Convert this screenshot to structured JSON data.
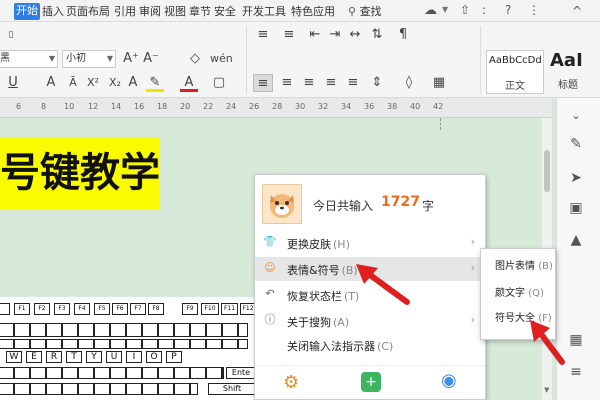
{
  "menubar": {
    "tabs": [
      {
        "label": "开始"
      },
      {
        "label": "插入"
      },
      {
        "label": "页面布局"
      },
      {
        "label": "引用"
      },
      {
        "label": "审阅"
      },
      {
        "label": "视图"
      },
      {
        "label": "章节"
      },
      {
        "label": "安全"
      },
      {
        "label": "开发工具"
      },
      {
        "label": "特色应用"
      }
    ],
    "search_label": "查找",
    "help_symbol": "?",
    "more_symbol": ":",
    "collapse_symbol": "^"
  },
  "ribbon": {
    "font_name": "黑",
    "font_size": "小初",
    "styles": [
      {
        "sample": "AaBbCcDd",
        "label": "正文"
      },
      {
        "sample": "AaI",
        "label": "标题"
      }
    ],
    "accent_color": "#2f7ee8"
  },
  "ruler": {
    "ticks": [
      "6",
      "8",
      "10",
      "12",
      "14",
      "16",
      "18",
      "20",
      "22",
      "24",
      "26",
      "28",
      "30",
      "32",
      "34",
      "36",
      "38",
      "40",
      "42"
    ]
  },
  "document": {
    "heading": "号键教学"
  },
  "keyboard": {
    "f_row": [
      "F1",
      "F2",
      "F3",
      "F4",
      "F5",
      "F6",
      "F7",
      "F8",
      "F9",
      "F10",
      "F11",
      "F12"
    ],
    "row2": [
      "W",
      "E",
      "R",
      "T",
      "Y",
      "U",
      "I",
      "O",
      "P"
    ],
    "enter_label": "Ente",
    "shift_label": "Shift"
  },
  "ime_menu": {
    "count_prefix": "今日共输入",
    "count_value": "1727",
    "count_unit": "字",
    "items": [
      {
        "label": "更换皮肤",
        "shortcut": "(H)",
        "icon": "shirt-icon",
        "has_submenu": true
      },
      {
        "label": "表情&符号",
        "shortcut": "(B)",
        "icon": "smiley-icon",
        "has_submenu": true,
        "highlighted": true
      },
      {
        "label": "恢复状态栏",
        "shortcut": "(T)",
        "icon": "restore-icon",
        "has_submenu": false
      },
      {
        "label": "关于搜狗",
        "shortcut": "(A)",
        "icon": "question-icon",
        "has_submenu": true
      },
      {
        "label": "关闭输入法指示器",
        "shortcut": "(C)",
        "icon": "",
        "has_submenu": false
      }
    ],
    "bottom_icons": [
      "gear-icon",
      "store-icon",
      "mic-icon"
    ]
  },
  "submenu": {
    "items": [
      {
        "label": "图片表情",
        "shortcut": "(B)"
      },
      {
        "label": "颜文字",
        "shortcut": "(Q)"
      },
      {
        "label": "符号大全",
        "shortcut": "(F)"
      }
    ]
  },
  "colors": {
    "arrow": "#e02020",
    "highlight_number": "#ef6b1a",
    "yellow_bg": "#fbfb00",
    "doc_bg": "#d7ead9"
  }
}
